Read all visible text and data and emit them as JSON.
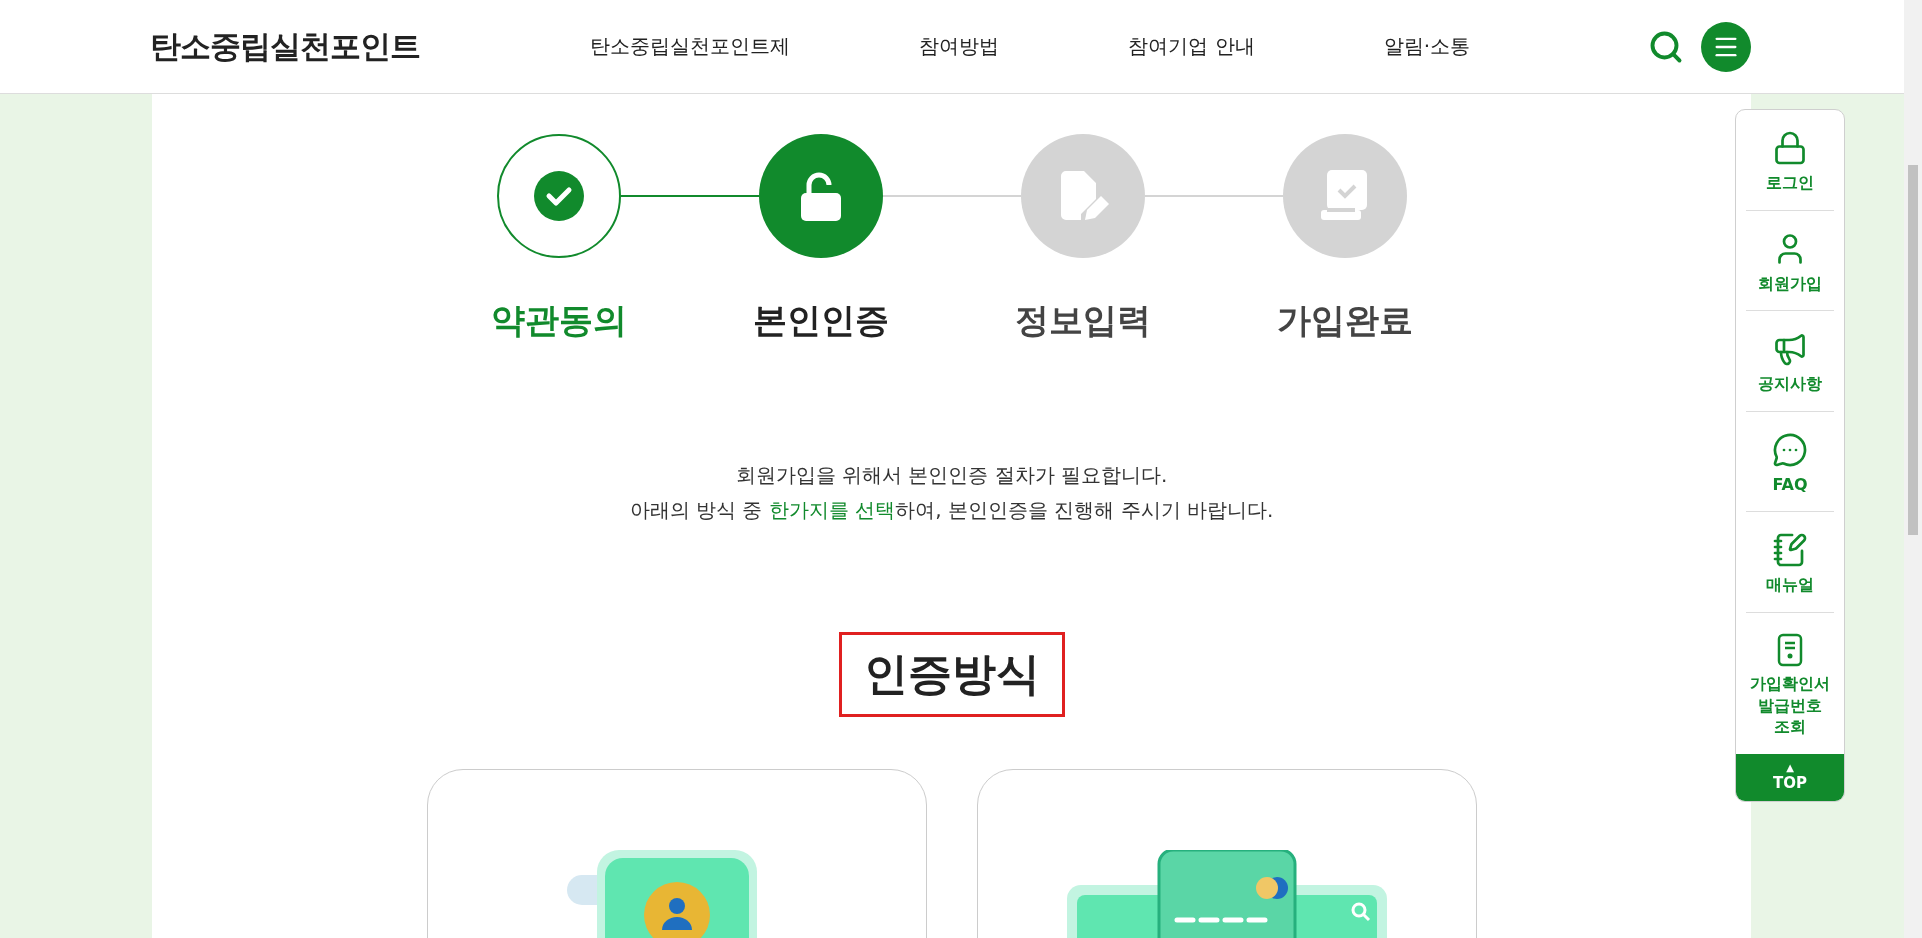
{
  "header": {
    "logo": "탄소중립실천포인트",
    "nav": [
      "탄소중립실천포인트제",
      "참여방법",
      "참여기업 안내",
      "알림·소통"
    ]
  },
  "steps": [
    {
      "label": "약관동의",
      "done": true,
      "selected": false
    },
    {
      "label": "본인인증",
      "done": false,
      "selected": true
    },
    {
      "label": "정보입력",
      "done": false,
      "selected": false
    },
    {
      "label": "가입완료",
      "done": false,
      "selected": false
    }
  ],
  "intro": [
    "회원가입을 위해서 본인인증 절차가 필요합니다.",
    "아래의 방식 중 **한가지를 선택**하여, 본인인증을 진행해 주시기 바랍니다."
  ],
  "section_title": "인증방식",
  "methods": [
    {
      "kind": "phone"
    },
    {
      "kind": "card"
    }
  ],
  "quick_menu": {
    "items": [
      {
        "kind": "lock",
        "label": "로그인"
      },
      {
        "kind": "user",
        "label": "회원가입"
      },
      {
        "kind": "megaphone",
        "label": "공지사항"
      },
      {
        "kind": "chat",
        "label": "FAQ"
      },
      {
        "kind": "manual",
        "label": "매뉴얼"
      },
      {
        "kind": "certificate",
        "label": "가입확인서 발급번호 조회"
      }
    ],
    "top": {
      "arrow": "▲",
      "label": "TOP"
    }
  }
}
